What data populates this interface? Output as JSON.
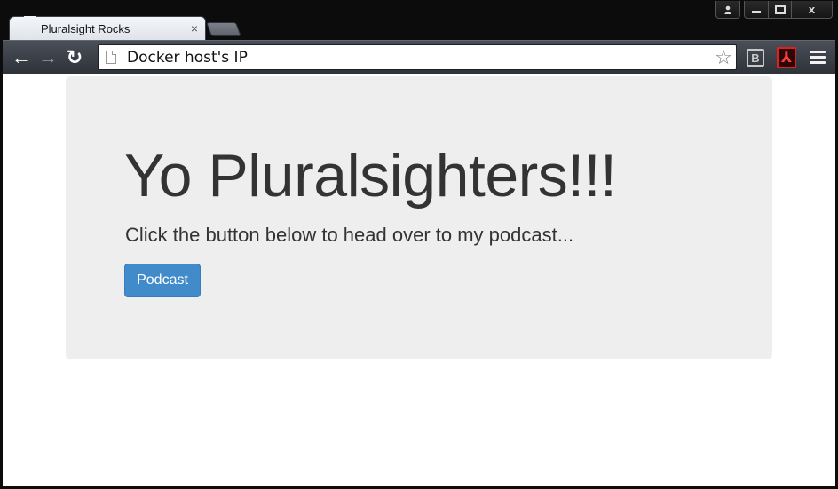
{
  "window": {
    "caption_buttons": [
      {
        "name": "user",
        "icon": "user-icon"
      },
      {
        "name": "minimize",
        "icon": "minimize-icon"
      },
      {
        "name": "maximize",
        "icon": "maximize-icon"
      },
      {
        "name": "close",
        "label": "x",
        "icon": "close-icon"
      }
    ]
  },
  "tab": {
    "title": "Pluralsight Rocks",
    "close": "×",
    "icon": "page-icon"
  },
  "toolbar": {
    "back_icon": "←",
    "forward_icon": "→",
    "reload_icon": "↻",
    "url": "Docker host's IP",
    "bookmark_icon": "☆",
    "ext_b_label": "B",
    "ext_pdf_label": "⅄",
    "colors": {
      "frame": "#0c0c0c",
      "toolbar": "#3b3f47"
    }
  },
  "page": {
    "heading": "Yo Pluralsighters!!!",
    "lead": "Click the button below to head over to my podcast...",
    "button_label": "Podcast",
    "colors": {
      "jumbotron_bg": "#eeeeee",
      "button_bg": "#428bca",
      "text": "#333333"
    }
  }
}
